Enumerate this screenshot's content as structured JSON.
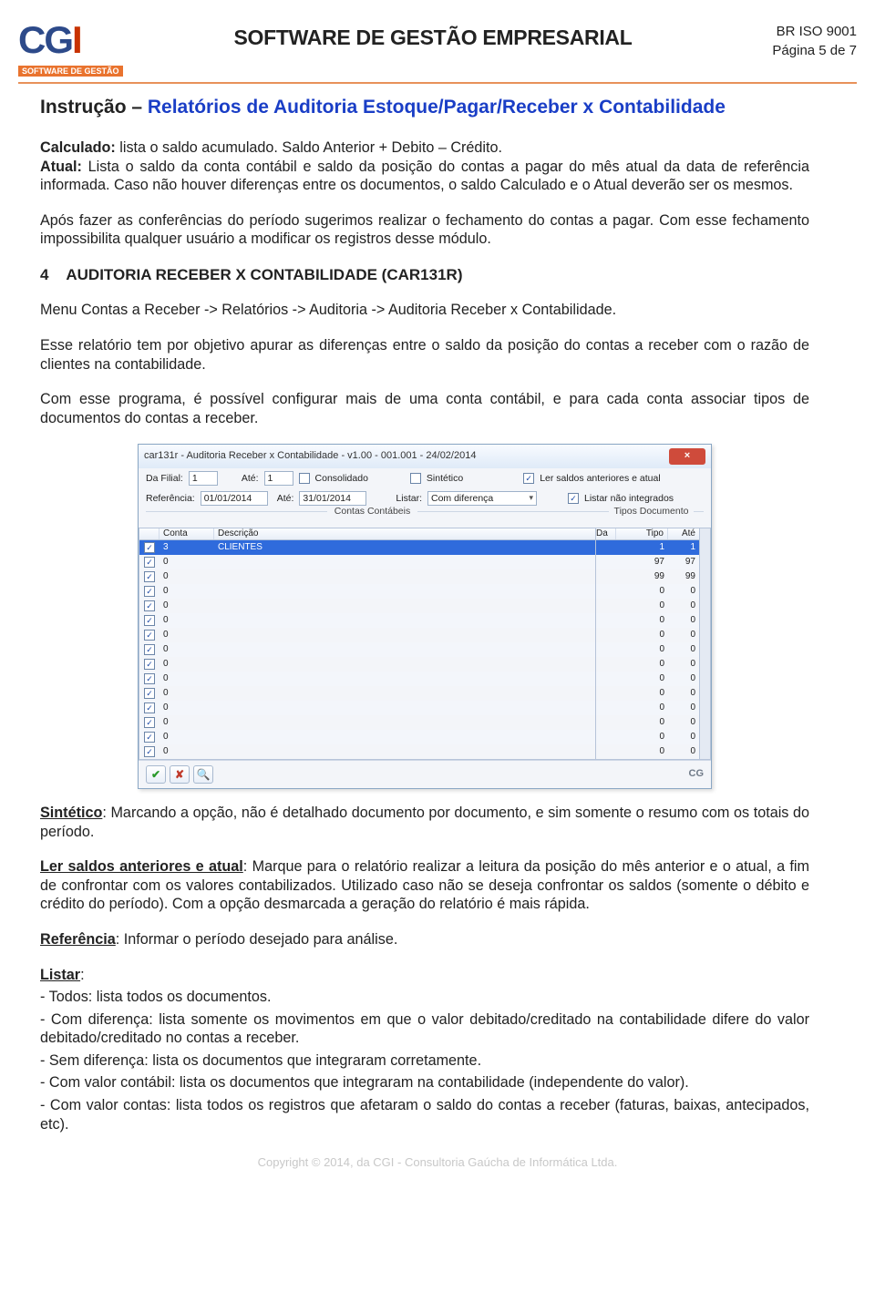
{
  "header": {
    "logo_main": "CG",
    "logo_accent": "I",
    "logo_sub": "SOFTWARE DE GESTÃO",
    "title": "SOFTWARE DE GESTÃO EMPRESARIAL",
    "iso": "BR ISO 9001",
    "page": "Página  5 de 7"
  },
  "instruction": {
    "prefix": "Instrução – ",
    "title": "Relatórios de Auditoria Estoque/Pagar/Receber x Contabilidade"
  },
  "paragraphs": {
    "p1a_label": "Calculado:",
    "p1a": " lista o saldo acumulado. Saldo Anterior + Debito – Crédito.",
    "p1b_label": "Atual:",
    "p1b": " Lista o saldo da conta contábil e saldo da posição do contas a pagar do mês atual da data de referência informada. Caso não houver diferenças entre os documentos, o saldo Calculado e o Atual deverão ser os mesmos.",
    "p2": "Após fazer as conferências do período sugerimos realizar o fechamento do contas a pagar. Com esse fechamento impossibilita qualquer usuário a modificar os registros desse módulo.",
    "sec_num": "4",
    "sec_title": "AUDITORIA RECEBER X CONTABILIDADE (CAR131R)",
    "p3": "Menu Contas a Receber -> Relatórios -> Auditoria -> Auditoria   Receber x Contabilidade.",
    "p4": "Esse relatório tem por objetivo apurar as diferenças entre o saldo da posição do contas a receber  com o razão de clientes na contabilidade.",
    "p5": "Com esse programa, é possível configurar mais de uma conta contábil, e para cada conta associar tipos de documentos do contas a receber.",
    "p6_label": "Sintético",
    "p6": ": Marcando a opção, não é detalhado documento por documento, e sim somente o resumo com os totais do período.",
    "p7_label": "Ler saldos anteriores e atual",
    "p7": ": Marque para o relatório realizar a leitura da posição do mês anterior e o atual, a fim de confrontar com os valores contabilizados. Utilizado caso não se deseja confrontar os saldos (somente o débito e crédito do período). Com a opção desmarcada a geração do relatório é mais rápida.",
    "p8_label": "Referência",
    "p8": ": Informar o período desejado para análise.",
    "p9_label": "Listar",
    "p9a": "- Todos: lista todos os documentos.",
    "p9b": "- Com diferença: lista somente os movimentos em que o valor debitado/creditado na contabilidade difere do valor debitado/creditado no contas a receber.",
    "p9c": "- Sem diferença: lista os documentos que integraram corretamente.",
    "p9d": "- Com valor contábil: lista os documentos que integraram na contabilidade (independente do valor).",
    "p9e": "- Com valor contas: lista todos os registros que afetaram o saldo do contas a receber (faturas, baixas, antecipados, etc)."
  },
  "screenshot": {
    "title": "car131r - Auditoria Receber x Contabilidade - v1.00 - 001.001 - 24/02/2014",
    "fields": {
      "da_filial_lbl": "Da Filial:",
      "da_filial_val": "1",
      "ate_lbl": "Até:",
      "ate_val": "1",
      "consolidado_lbl": "Consolidado",
      "sintetico_lbl": "Sintético",
      "ler_saldos_lbl": "Ler saldos anteriores e atual",
      "ref_lbl": "Referência:",
      "ref_val": "01/01/2014",
      "ref_ate_lbl": "Até:",
      "ref_ate_val": "31/01/2014",
      "listar_lbl": "Listar:",
      "listar_val": "Com diferença",
      "listar_nao_int_lbl": "Listar não integrados"
    },
    "group_left": "Contas Contábeis",
    "group_right": "Tipos Documento",
    "grid_left_headers": {
      "c2": "Conta",
      "c3": "Descrição"
    },
    "grid_right_headers": {
      "c1": "Da",
      "c2": "Tipo",
      "c3": "Até"
    },
    "left_rows": [
      {
        "sel": true,
        "conta": "3",
        "descr": "CLIENTES"
      },
      {
        "sel": false,
        "conta": "0",
        "descr": ""
      },
      {
        "sel": false,
        "conta": "0",
        "descr": ""
      },
      {
        "sel": false,
        "conta": "0",
        "descr": ""
      },
      {
        "sel": false,
        "conta": "0",
        "descr": ""
      },
      {
        "sel": false,
        "conta": "0",
        "descr": ""
      },
      {
        "sel": false,
        "conta": "0",
        "descr": ""
      },
      {
        "sel": false,
        "conta": "0",
        "descr": ""
      },
      {
        "sel": false,
        "conta": "0",
        "descr": ""
      },
      {
        "sel": false,
        "conta": "0",
        "descr": ""
      },
      {
        "sel": false,
        "conta": "0",
        "descr": ""
      },
      {
        "sel": false,
        "conta": "0",
        "descr": ""
      },
      {
        "sel": false,
        "conta": "0",
        "descr": ""
      },
      {
        "sel": false,
        "conta": "0",
        "descr": ""
      },
      {
        "sel": false,
        "conta": "0",
        "descr": ""
      }
    ],
    "right_rows": [
      {
        "sel": true,
        "tipo": "1",
        "ate": "1"
      },
      {
        "sel": false,
        "tipo": "97",
        "ate": "97"
      },
      {
        "sel": false,
        "tipo": "99",
        "ate": "99"
      },
      {
        "sel": false,
        "tipo": "0",
        "ate": "0"
      },
      {
        "sel": false,
        "tipo": "0",
        "ate": "0"
      },
      {
        "sel": false,
        "tipo": "0",
        "ate": "0"
      },
      {
        "sel": false,
        "tipo": "0",
        "ate": "0"
      },
      {
        "sel": false,
        "tipo": "0",
        "ate": "0"
      },
      {
        "sel": false,
        "tipo": "0",
        "ate": "0"
      },
      {
        "sel": false,
        "tipo": "0",
        "ate": "0"
      },
      {
        "sel": false,
        "tipo": "0",
        "ate": "0"
      },
      {
        "sel": false,
        "tipo": "0",
        "ate": "0"
      },
      {
        "sel": false,
        "tipo": "0",
        "ate": "0"
      },
      {
        "sel": false,
        "tipo": "0",
        "ate": "0"
      },
      {
        "sel": false,
        "tipo": "0",
        "ate": "0"
      }
    ],
    "footer_brand": "CG"
  },
  "footer": "Copyright © 2014, da CGI  - Consultoria Gaúcha de Informática Ltda."
}
